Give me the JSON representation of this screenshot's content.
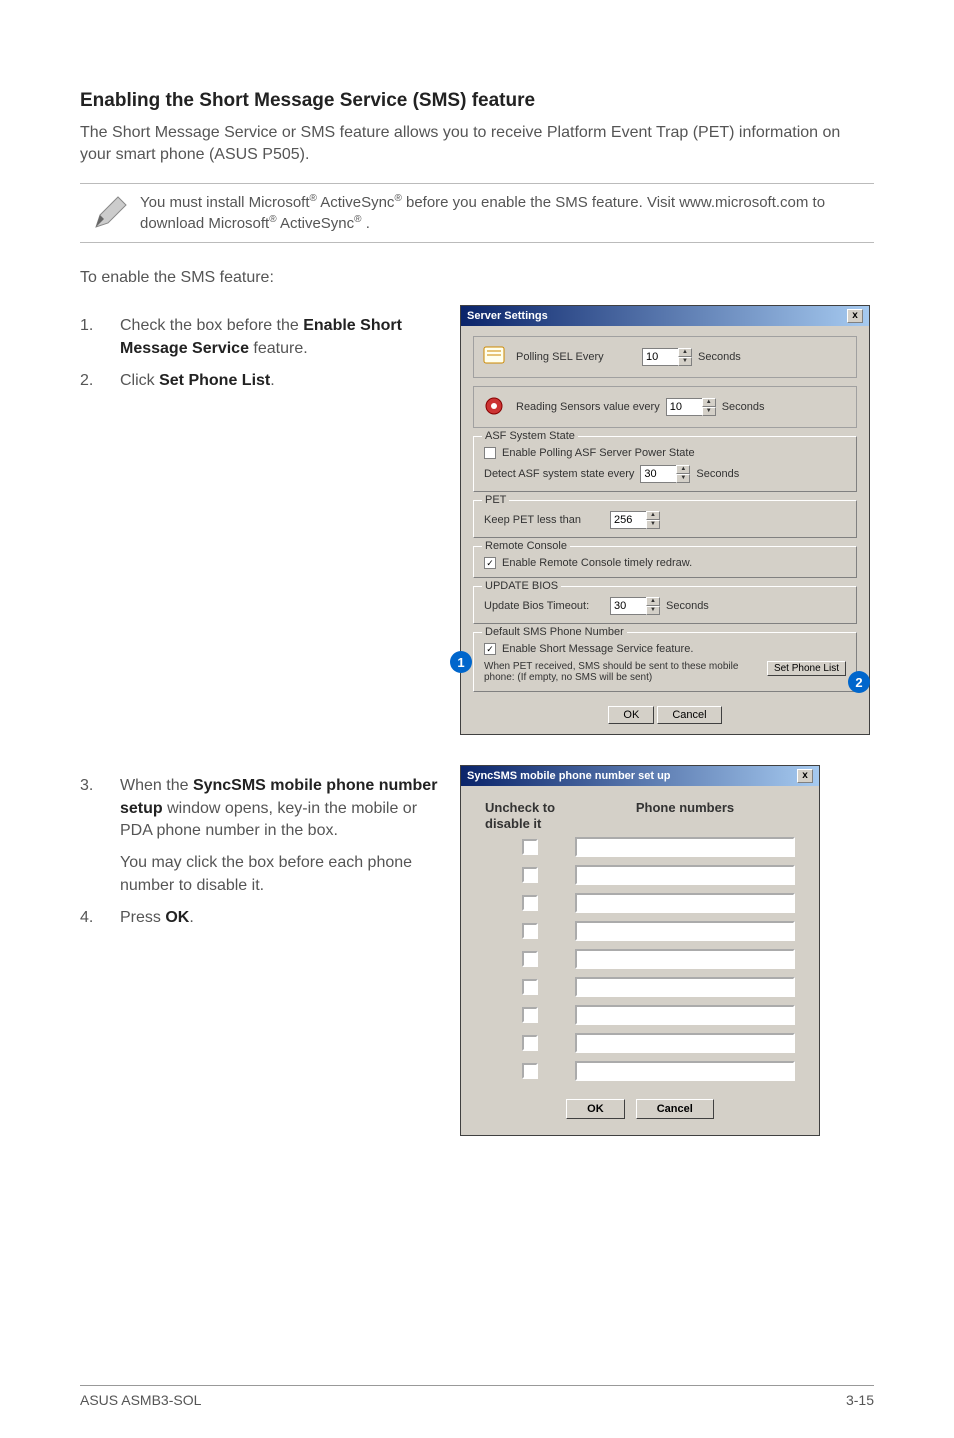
{
  "heading": "Enabling the Short Message Service (SMS) feature",
  "intro": "The Short Message Service or SMS feature allows you to receive Platform Event Trap (PET) information on your smart phone (ASUS P505).",
  "note": {
    "line1a": "You must install Microsoft",
    "line1b": " ActiveSync",
    "line1c": " before you enable the SMS feature. Visit www.microsoft.com to download Microsoft",
    "line1d": " ActiveSync",
    "line1e": " .",
    "sup": "®"
  },
  "lead": "To enable the SMS feature:",
  "steps": {
    "s1_num": "1.",
    "s1_a": "Check the box before the ",
    "s1_bold": "Enable Short Message Service",
    "s1_b": " feature.",
    "s2_num": "2.",
    "s2_a": "Click ",
    "s2_bold": "Set Phone List",
    "s2_b": ".",
    "s3_num": "3.",
    "s3_a": "When the ",
    "s3_bold": "SyncSMS mobile phone number setup",
    "s3_b": " window opens, key-in the mobile or PDA phone number in the box.",
    "s3_sub": "You may click the box before each phone number to disable it.",
    "s4_num": "4.",
    "s4_a": " Press ",
    "s4_bold": "OK",
    "s4_b": "."
  },
  "dlg1": {
    "title": "Server Settings",
    "close": "x",
    "polling_label": "Polling SEL Every",
    "polling_value": "10",
    "seconds": "Seconds",
    "sensors_label": "Reading Sensors value every",
    "sensors_value": "10",
    "asf_title": "ASF System State",
    "asf_chk": "Enable Polling ASF Server Power State",
    "asf_detect": "Detect ASF system state every",
    "asf_value": "30",
    "pet_title": "PET",
    "pet_label": "Keep PET less than",
    "pet_value": "256",
    "rc_title": "Remote Console",
    "rc_chk": "Enable Remote Console timely redraw.",
    "bios_title": "UPDATE BIOS",
    "bios_label": "Update Bios Timeout:",
    "bios_value": "30",
    "sms_title": "Default SMS Phone Number",
    "sms_chk": "Enable Short Message Service feature.",
    "sms_desc": "When PET received, SMS should be sent to these mobile phone: (If empty, no SMS will be sent)",
    "sms_btn": "Set Phone List",
    "ok": "OK",
    "cancel": "Cancel",
    "callout1": "1",
    "callout2": "2"
  },
  "dlg2": {
    "title": "SyncSMS mobile phone number set up",
    "close": "x",
    "col1": "Uncheck to disable it",
    "col2": "Phone numbers",
    "ok": "OK",
    "cancel": "Cancel"
  },
  "footer": {
    "left": "ASUS ASMB3-SOL",
    "right": "3-15"
  }
}
